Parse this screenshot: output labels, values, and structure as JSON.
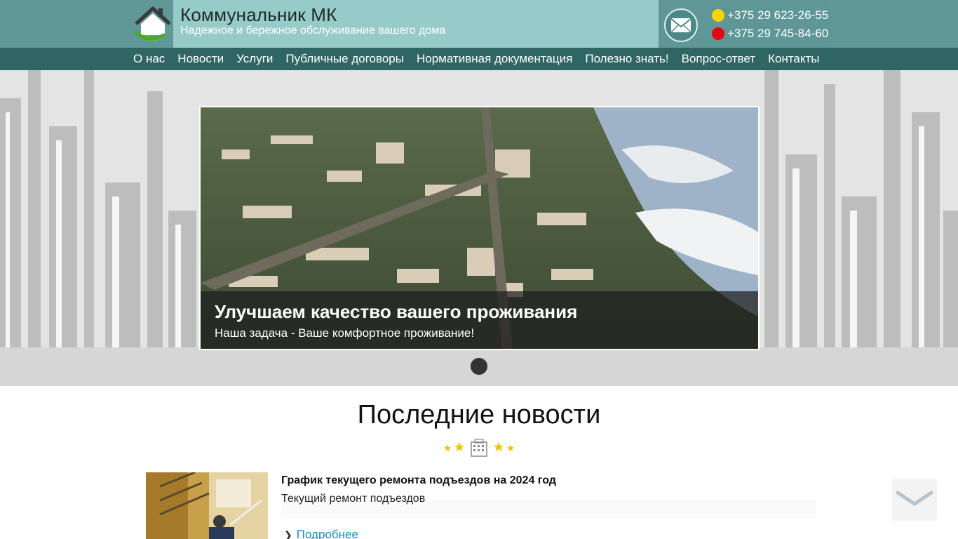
{
  "header": {
    "title": "Коммунальник МК",
    "tagline": "Надежное и бережное обслуживание вашего дома",
    "phones": [
      {
        "operator_icon": "velcom-icon",
        "number": "+375 29 623-26-55"
      },
      {
        "operator_icon": "mts-icon",
        "number": "+375 29 745-84-60"
      }
    ]
  },
  "nav": {
    "items": [
      {
        "label": "О нас"
      },
      {
        "label": "Новости"
      },
      {
        "label": "Услуги"
      },
      {
        "label": "Публичные договоры"
      },
      {
        "label": "Нормативная документация"
      },
      {
        "label": "Полезно знать!"
      },
      {
        "label": "Вопрос-ответ"
      },
      {
        "label": "Контакты"
      }
    ]
  },
  "slider": {
    "title": "Улучшаем качество вашего проживания",
    "subtitle": "Наша задача - Ваше комфортное проживание!"
  },
  "news": {
    "heading": "Последние новости",
    "items": [
      {
        "title": "График текущего ремонта подъездов на 2024 год",
        "subtitle": "Текущий ремонт подъездов",
        "more_label": "Подробнее"
      }
    ]
  },
  "colors": {
    "header_bg": "#5f9896",
    "brand_panel": "#97cbc9",
    "nav_bg": "#2f6664",
    "link": "#1a86c9"
  }
}
